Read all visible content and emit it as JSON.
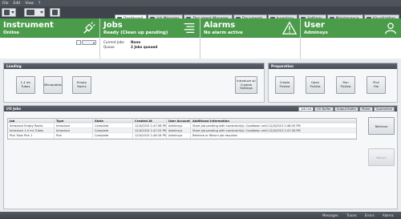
{
  "menu": [
    "File",
    "Edit",
    "View",
    "?"
  ],
  "tabs": [
    {
      "label": "Dashboard",
      "icon": "dashboard-icon",
      "active": true
    },
    {
      "label": "Job Manager",
      "icon": "job-manager-icon",
      "active": false
    },
    {
      "label": "Document Manager",
      "icon": "document-manager-icon",
      "active": false
    },
    {
      "label": "Documents",
      "icon": "documents-icon",
      "active": false
    },
    {
      "label": "Inventory",
      "icon": "inventory-icon",
      "active": false
    },
    {
      "label": "Settings",
      "icon": "settings-icon",
      "active": false
    },
    {
      "label": "Maintenance",
      "icon": "maintenance-icon",
      "active": false
    },
    {
      "label": "Visualization",
      "icon": "visualization-icon",
      "active": false
    }
  ],
  "instrument": {
    "title": "Instrument",
    "status": "Online"
  },
  "jobs": {
    "title": "Jobs",
    "status": "Ready (Clean up pending)",
    "current_label": "Current Jobs",
    "current_value": "None",
    "queue_label": "Queue",
    "queue_value": "2 Jobs queued"
  },
  "alarms": {
    "title": "Alarms",
    "status": "No alarm active"
  },
  "user": {
    "title": "User",
    "status": "Adminsys"
  },
  "loading": {
    "title": "Loading",
    "buttons": [
      "1.4 mL\nTubes",
      "Microplates",
      "Empty\nRacks"
    ],
    "intro_button": "Introduce w/\nCustom\nSettings"
  },
  "preparation": {
    "title": "Preparation",
    "buttons": [
      "Create\nPicklist",
      "Open\nPicklist",
      "Run\nPicklist",
      "Pick\nFile"
    ]
  },
  "io_jobs": {
    "title": "I/O Jobs",
    "tabs": [
      "Job List",
      "I/O Buffer",
      "Output Buffer",
      "Picker",
      "Quarantine"
    ],
    "columns": [
      "Job",
      "Type",
      "State",
      "Created At",
      "User Account",
      "Additional Information"
    ],
    "rows": [
      [
        "Introduce Empty Racks",
        "Introduce",
        "Complete",
        "12/4/2015 1:47:58 PM",
        "Adminsys",
        "Store job pending with constraint(s): Cooldown until 12/4/2015 2:48:05 PM"
      ],
      [
        "Introduce 1.4 mL Tubes",
        "Introduce",
        "Complete",
        "12/4/2015 1:47:23 PM",
        "Adminsys",
        "Store job pending with constraint(s): Cooldown until 12/4/2015 2:47:26 PM"
      ],
      [
        "Pick Tube Pick 1",
        "Pick",
        "Complete",
        "12/4/2015 1:46:16 PM",
        "Adminsys",
        "Retrieve or Return job required"
      ]
    ],
    "retrieve_label": "Retrieve",
    "return_label": "Return"
  },
  "statusbar": [
    "Messages",
    "Traces",
    "Errors",
    "Alarms"
  ]
}
